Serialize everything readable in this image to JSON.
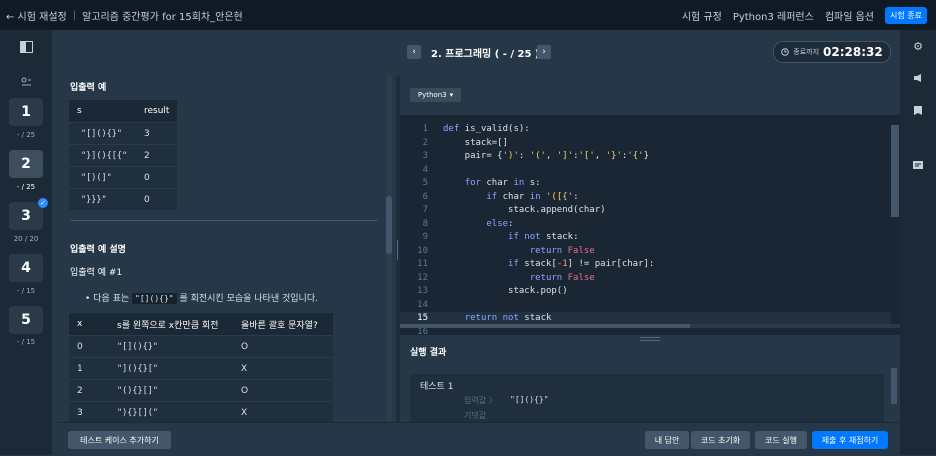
{
  "topbar": {
    "back_label": "← 시험 재설정",
    "exam_title": "알고리즘 중간평가 for 15회차_안은현",
    "menu": [
      "시험 규정",
      "Python3 레퍼런스",
      "컴파일 옵션"
    ],
    "end_label": "시험 종료"
  },
  "sidebar": {
    "questions": [
      {
        "number": "1",
        "score": "- / 25"
      },
      {
        "number": "2",
        "score": "- / 25"
      },
      {
        "number": "3",
        "score": "20 / 20",
        "check": "✓"
      },
      {
        "number": "4",
        "score": "- / 15"
      },
      {
        "number": "5",
        "score": "- / 15"
      }
    ]
  },
  "header": {
    "prev": "‹",
    "next": "›",
    "title": "2. 프로그래밍 ( - / 25 )",
    "timer_label": "종료까지",
    "timer_value": "02:28:32"
  },
  "problem": {
    "io_example_heading": "입출력 예",
    "io_table": {
      "headers": [
        "s",
        "result"
      ],
      "rows": [
        [
          "\"[](){}\"",
          "3"
        ],
        [
          "\"}](){[{\"",
          "2"
        ],
        [
          "\"[)(]\"",
          "0"
        ],
        [
          "\"}}}\"",
          "0"
        ]
      ]
    },
    "explain_heading": "입출력 예 설명",
    "example1_heading": "입출력 예 #1",
    "bullet_before": "다음 표는",
    "bullet_code": "\"[](){}\"",
    "bullet_after": "를 회전시킨 모습을 나타낸 것입니다.",
    "rot_table": {
      "headers": [
        "x",
        "s를 왼쪽으로 x칸만큼 회전",
        "올바른 괄호 문자열?"
      ],
      "rows": [
        [
          "0",
          "\"[](){}\"",
          "O"
        ],
        [
          "1",
          "\"](){}[\"",
          "X"
        ],
        [
          "2",
          "\"(){}[]\"",
          "O"
        ],
        [
          "3",
          "\"){}[](\"",
          "X"
        ]
      ]
    }
  },
  "editor": {
    "language": "Python3",
    "lines": [
      "def is_valid(s):",
      "    stack=[]",
      "    pair= {')': '(', ']':'[', '}':'{'}",
      "",
      "    for char in s:",
      "        if char in '([{':",
      "            stack.append(char)",
      "        else:",
      "            if not stack:",
      "                return False",
      "            if stack[-1] != pair[char]:",
      "                return False",
      "            stack.pop()",
      "",
      "    return not stack",
      ""
    ]
  },
  "result": {
    "title": "실행 결과",
    "test_label": "테스트 1",
    "input_label": "입력값 〉",
    "input_value": "\"[](){}\"",
    "expected_label": "기댓값"
  },
  "bottom": {
    "add_testcase": "테스트 케이스 추가하기",
    "my_answer": "내 답안",
    "reset_code": "코드 초기화",
    "run_code": "코드 실행",
    "submit": "제출 후 채점하기"
  },
  "colors": {
    "accent": "#0078ff",
    "background": "#263747",
    "topbar": "#0f1a24"
  }
}
